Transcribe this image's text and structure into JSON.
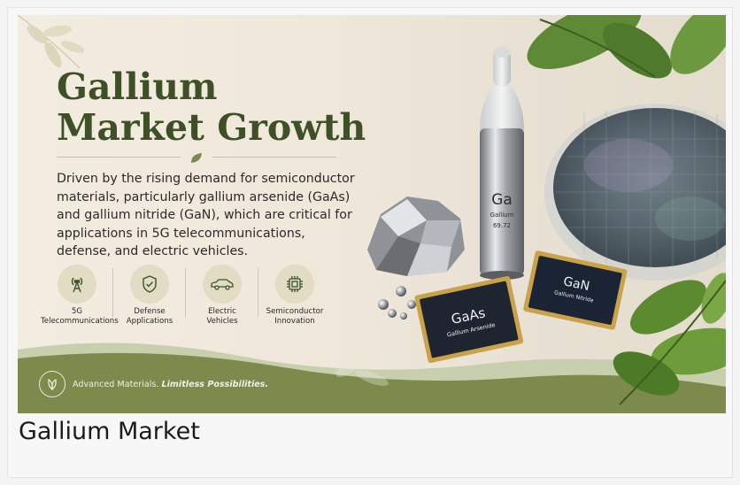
{
  "banner": {
    "title_line1": "Gallium",
    "title_line2": "Market Growth",
    "description": "Driven by the rising demand for semiconductor materials, particularly gallium arsenide (GaAs) and gallium nitride (GaN), which are critical for applications in 5G telecommunications, defense, and electric vehicles.",
    "features": [
      {
        "label": "5G\nTelecommunications",
        "icon": "antenna-icon"
      },
      {
        "label": "Defense\nApplications",
        "icon": "shield-check-icon"
      },
      {
        "label": "Electric\nVehicles",
        "icon": "car-icon"
      },
      {
        "label": "Semiconductor\nInnovation",
        "icon": "chip-icon"
      }
    ],
    "tagline_plain": "Advanced Materials. ",
    "tagline_bold": "Limitless Possibilities.",
    "vial": {
      "symbol": "Ga",
      "name": "Gallium",
      "mass": "69.72"
    },
    "chips": [
      {
        "symbol": "GaAs",
        "name": "Gallium Arsenide"
      },
      {
        "symbol": "GaN",
        "name": "Gallium Nitride"
      }
    ],
    "colors": {
      "title": "#3e5126",
      "footer": "#7c8a4c",
      "accent": "#c8cfae"
    }
  },
  "caption": "Gallium Market"
}
